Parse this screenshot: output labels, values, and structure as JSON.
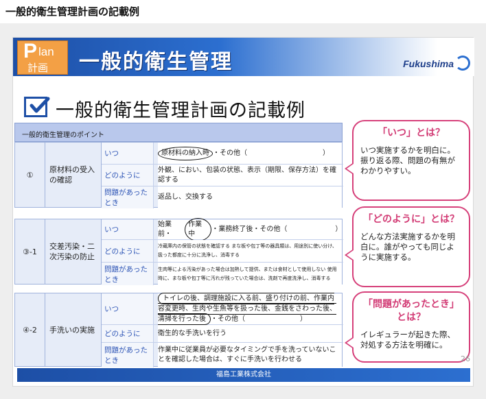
{
  "page_title": "一般的衛生管理計画の記載例",
  "banner": {
    "plan_letter": "P",
    "plan_rest": "lan",
    "plan_sub": "計画",
    "title": "一般的衛生管理",
    "logo": "Fukushima"
  },
  "slide_heading": "一般的衛生管理計画の記載例",
  "table_header": "一般的衛生管理のポイント",
  "sections": [
    {
      "num": "①",
      "name": "原材料の受入の確認",
      "rows": [
        {
          "label": "いつ",
          "circled": "原材料の納入時",
          "text": "・その他（　　　　　　　　　　　）"
        },
        {
          "label": "どのように",
          "text": "外観、におい、包装の状態、表示（期限、保存方法）を確認する"
        },
        {
          "label": "問題があったとき",
          "text": "返品し、交換する"
        }
      ]
    },
    {
      "num": "③-1",
      "name": "交差汚染・二次汚染の防止",
      "rows": [
        {
          "label": "いつ",
          "prefix": "始業前・",
          "circled": "作業中",
          "text": "・業務終了後・その他（　　　　　　　）"
        },
        {
          "label": "どのように",
          "text": "冷蔵庫内の保管の状態を確認する まな板や包丁等の器具類は、用途別に使い分け、扱った都度に十分に洗浄し、消毒する"
        },
        {
          "label": "問題があったとき",
          "text": "生肉等による汚染があった場合は加熱して提供、または食材として使用しない 使用時に、まな板や包丁等に汚れが残っていた場合は、洗剤で再度洗浄し、消毒する"
        }
      ]
    },
    {
      "num": "④-2",
      "name": "手洗いの実施",
      "rows": [
        {
          "label": "いつ",
          "circled": "トイレの後、調理施設に入る前、盛り付けの前、作業内容変更時、生肉や生魚等を扱った後、金銭をさわった後、清掃を行った後",
          "text": "・その他（　　　　　　　　）"
        },
        {
          "label": "どのように",
          "text": "衛生的な手洗いを行う"
        },
        {
          "label": "問題があったとき",
          "text": "作業中に従業員が必要なタイミングで手を洗っていないことを確認した場合は、すぐに手洗いを行わせる"
        }
      ]
    }
  ],
  "callouts": [
    {
      "title": "「いつ」とは？",
      "text": "いつ実施するかを明白に。振り返る際、問題の有無がわかりやすい。"
    },
    {
      "title": "「どのように」とは？",
      "text": "どんな方法実施するかを明白に。誰がやっても同じように実施する。"
    },
    {
      "title": "「問題があったとき」とは？",
      "text": "イレギュラーが起きた際、対処する方法を明確に。"
    }
  ],
  "page_number": "26",
  "footer": "福島工業株式会社",
  "colors": {
    "accent_blue": "#1d4fa6",
    "callout_pink": "#d6407a",
    "plan_orange": "#f3a045"
  }
}
